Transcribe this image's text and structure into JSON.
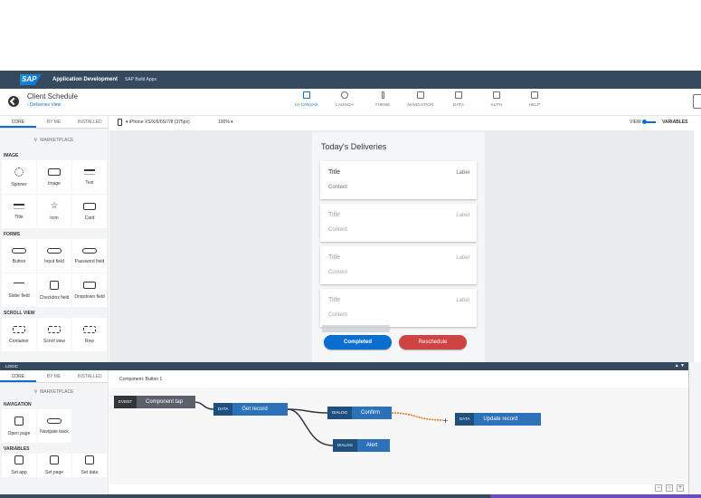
{
  "shell": {
    "logo": "SAP",
    "title": "Application Development",
    "subtitle": "SAP Build Apps"
  },
  "header": {
    "project_title": "Client Schedule",
    "project_sub": "‹ Deliveries View",
    "nav": [
      {
        "label": "UI CANVAS",
        "icon": "canvas-icon"
      },
      {
        "label": "LAUNCH",
        "icon": "rocket-icon"
      },
      {
        "label": "THEME",
        "icon": "brush-icon"
      },
      {
        "label": "NAVIGATION",
        "icon": "list-icon"
      },
      {
        "label": "DATA",
        "icon": "folder-icon"
      },
      {
        "label": "AUTH",
        "icon": "doc-icon"
      },
      {
        "label": "HELP",
        "icon": "chat-icon"
      }
    ]
  },
  "left": {
    "tabs": [
      "CORE",
      "BY ME",
      "INSTALLED"
    ],
    "marketplace": "MARKETPLACE",
    "sections": {
      "image": "IMAGE",
      "forms": "FORMS",
      "scroll": "SCROLL VIEW"
    },
    "image_items": [
      "Spinner",
      "Image",
      "Text",
      "Title",
      "Icon",
      "Card"
    ],
    "form_items": [
      "Button",
      "Input field",
      "Password field",
      "Slider field",
      "Checkbox field",
      "Dropdown field"
    ],
    "scroll_items": [
      "Container",
      "Scroll view",
      "Row"
    ]
  },
  "devbar": {
    "device": "iPhone XS/X/6/6S/7/8 (375px)",
    "zoom": "100%",
    "view": "VIEW",
    "variables": "VARIABLES"
  },
  "canvas": {
    "title": "Today's Deliveries",
    "cards": [
      {
        "title": "Title",
        "label": "Label",
        "content": "Content"
      },
      {
        "title": "Title",
        "label": "Label",
        "content": "Content"
      },
      {
        "title": "Title",
        "label": "Label",
        "content": "Content"
      },
      {
        "title": "Title",
        "label": "Label",
        "content": "Content"
      }
    ],
    "btn_completed": "Completed",
    "btn_reschedule": "Reschedule"
  },
  "logic": {
    "bar": "LOGIC",
    "tabs": [
      "CORE",
      "BY ME",
      "INSTALLED"
    ],
    "marketplace": "MARKETPLACE",
    "sec_nav": "NAVIGATION",
    "sec_vars": "VARIABLES",
    "nav_items": [
      "Open page",
      "Navigate back"
    ],
    "var_items": [
      "Set app",
      "Set page",
      "Set data"
    ],
    "component": "Component: Button 1",
    "nodes": {
      "event": {
        "tag": "EVENT",
        "label": "Component tap"
      },
      "get": {
        "tag": "DATA",
        "label": "Get record"
      },
      "confirm": {
        "tag": "DIALOG",
        "label": "Confirm"
      },
      "alert": {
        "tag": "DIALOG",
        "label": "Alert"
      },
      "update": {
        "tag": "DATA",
        "label": "Update record"
      }
    }
  },
  "colors": {
    "shell": "#354a5f",
    "accent": "#0a6ed1",
    "danger": "#d04343"
  }
}
